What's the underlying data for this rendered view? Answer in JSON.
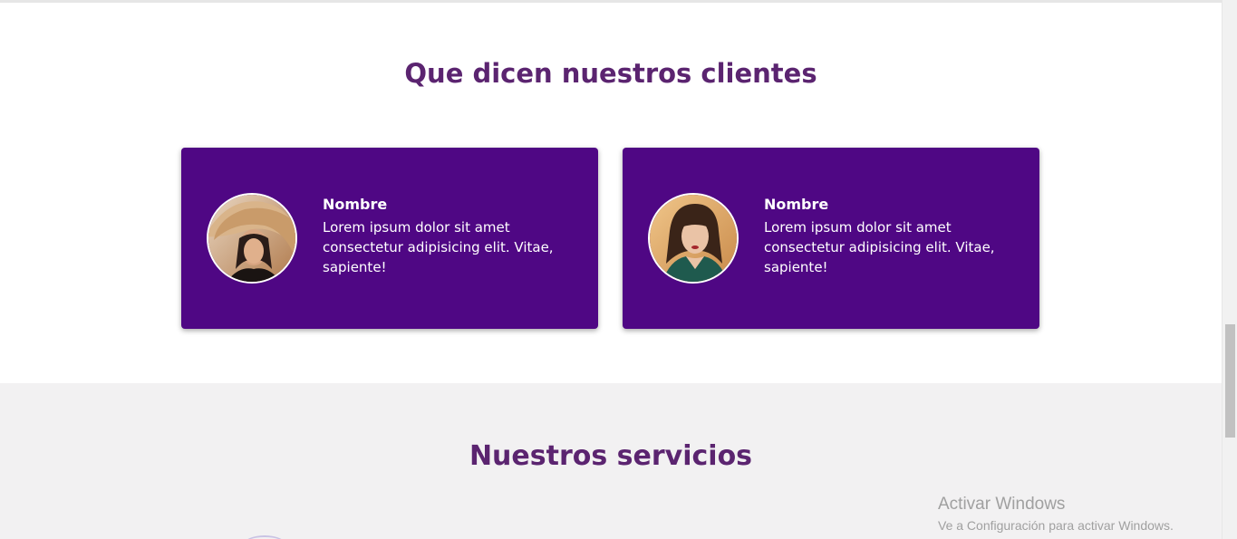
{
  "testimonials": {
    "title": "Que dicen nuestros clientes",
    "cards": [
      {
        "name": "Nombre",
        "quote": "Lorem ipsum dolor sit amet consectetur adipisicing elit. Vitae, sapiente!",
        "avatar_icon": "woman-hat-photo"
      },
      {
        "name": "Nombre",
        "quote": "Lorem ipsum dolor sit amet consectetur adipisicing elit. Vitae, sapiente!",
        "avatar_icon": "woman-portrait-photo"
      }
    ]
  },
  "services": {
    "title": "Nuestros servicios"
  },
  "watermark": {
    "title": "Activar Windows",
    "subtitle": "Ve a Configuración para activar Windows."
  },
  "colors": {
    "title": "#5b2470",
    "card_bg": "#4f0784",
    "services_bg": "#f2f1f2"
  }
}
